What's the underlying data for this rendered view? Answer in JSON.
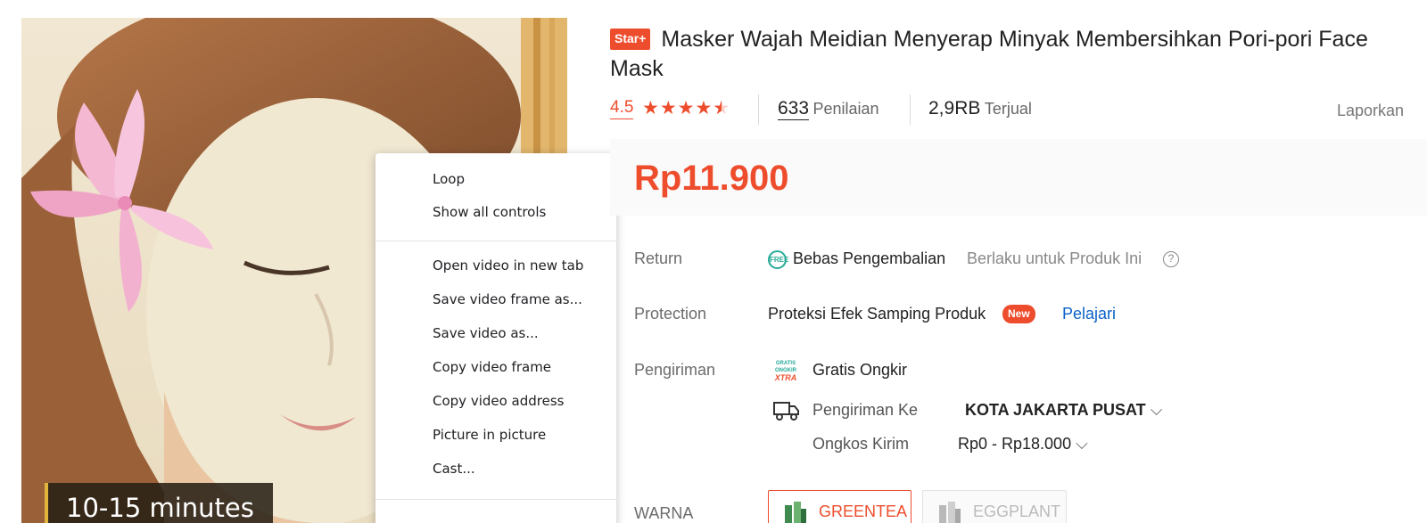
{
  "media": {
    "caption": "10-15 minutes"
  },
  "context_menu": {
    "group1": [
      "Loop",
      "Show all controls"
    ],
    "group2": [
      "Open video in new tab",
      "Save video frame as...",
      "Save video as...",
      "Copy video frame",
      "Copy video address",
      "Picture in picture",
      "Cast..."
    ]
  },
  "product": {
    "badge": "Star+",
    "title": "Masker Wajah Meidian Menyerap Minyak Membersihkan Pori-pori Face Mask",
    "rating": "4.5",
    "stars_value": 4.5,
    "stars_max": 5,
    "reviews_count": "633",
    "reviews_label": "Penilaian",
    "sold_count": "2,9RB",
    "sold_label": "Terjual",
    "report": "Laporkan",
    "price": "Rp11.900"
  },
  "details": {
    "return_label": "Return",
    "return_icon_text": "FREE",
    "return_value": "Bebas Pengembalian",
    "return_note": "Berlaku untuk Produk Ini",
    "protection_label": "Protection",
    "protection_value": "Proteksi Efek Samping Produk",
    "protection_badge": "New",
    "protection_link": "Pelajari",
    "shipping_label": "Pengiriman",
    "free_shipping_icon_text": [
      "GRATIS",
      "ONGKIR",
      "XTRA"
    ],
    "free_shipping": "Gratis Ongkir",
    "ship_to_label": "Pengiriman Ke",
    "ship_to_value": "KOTA JAKARTA PUSAT",
    "cost_label": "Ongkos Kirim",
    "cost_value": "Rp0 - Rp18.000",
    "variant_label": "WARNA",
    "variants": [
      {
        "label": "GREENTEA",
        "state": "selected"
      },
      {
        "label": "EGGPLANT",
        "state": "disabled"
      }
    ]
  },
  "colors": {
    "accent": "#ee4d2d",
    "link": "#0b62c9",
    "price_bg": "#fafafa"
  }
}
